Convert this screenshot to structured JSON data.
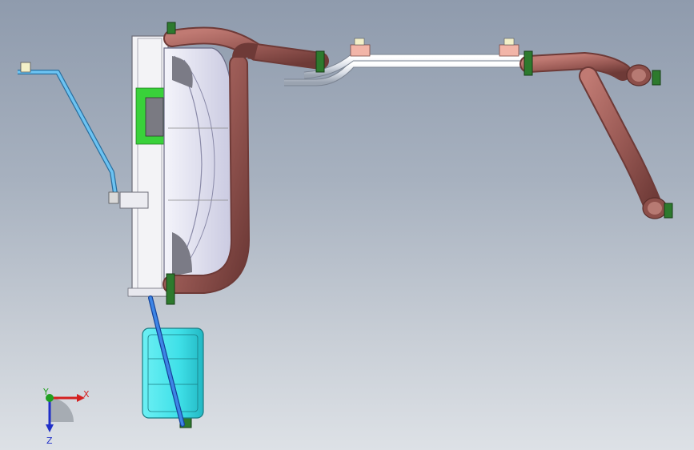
{
  "viewport": {
    "background_top": "#8f9bad",
    "background_bottom": "#dde1e6"
  },
  "colors": {
    "hose": "#9a5a55",
    "hose_dark": "#6e3a37",
    "pipe": "#e8ecf2",
    "bracket": "#5ab0e6",
    "radiator": "#f1f1f6",
    "fan": "#dcdcf0",
    "green_patch": "#39d13a",
    "tank": "#3fe0e8",
    "drain_tube": "#2a6ed8",
    "clamp": "#2d7a2d",
    "pad": "#f2b5a8"
  },
  "triad": {
    "x_label": "X",
    "y_label": "Y",
    "z_label": "Z",
    "x_color": "#d42020",
    "y_color": "#20a020",
    "z_color": "#2030c8"
  },
  "icons": [
    "coordinate-triad-icon"
  ]
}
